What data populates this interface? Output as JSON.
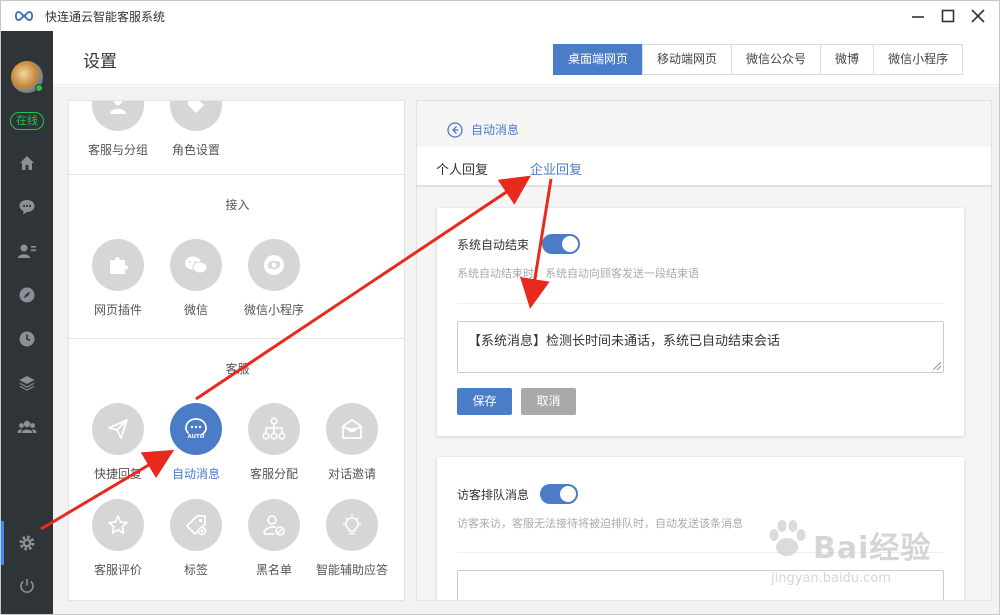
{
  "window": {
    "title": "快连通云智能客服系统",
    "icon": "infinity-logo-icon",
    "controls": [
      "minimize-icon",
      "maximize-icon",
      "close-icon"
    ]
  },
  "sidebar": {
    "status": "在线",
    "items": [
      {
        "icon": "home-icon"
      },
      {
        "icon": "chat-icon"
      },
      {
        "icon": "contacts-icon"
      },
      {
        "icon": "compass-icon"
      },
      {
        "icon": "clock-icon"
      },
      {
        "icon": "layers-icon"
      },
      {
        "icon": "team-icon"
      },
      {
        "icon": "gear-icon",
        "active": true
      },
      {
        "icon": "power-icon"
      }
    ]
  },
  "header": {
    "title": "设置",
    "tabs": [
      {
        "label": "桌面端网页",
        "active": true
      },
      {
        "label": "移动端网页"
      },
      {
        "label": "微信公众号"
      },
      {
        "label": "微博"
      },
      {
        "label": "微信小程序"
      }
    ]
  },
  "left_panel": {
    "top_items": [
      "客服与分组",
      "角色设置"
    ],
    "access": {
      "title": "接入",
      "items": [
        "网页插件",
        "微信",
        "微信小程序"
      ]
    },
    "service": {
      "title": "客服",
      "items": [
        "快捷回复",
        "自动消息",
        "客服分配",
        "对话邀请",
        "客服评价",
        "标签",
        "黑名单",
        "智能辅助应答"
      ],
      "active": "自动消息",
      "active_badge": "AUTO"
    }
  },
  "right_panel": {
    "back_label": "自动消息",
    "subtabs": [
      {
        "label": "个人回复"
      },
      {
        "label": "企业回复",
        "active": true
      }
    ],
    "auto_end": {
      "label": "系统自动结束",
      "enabled": true,
      "hint": "系统自动结束时，系统自动向顾客发送一段结束语",
      "message": "【系统消息】检测长时间未通话，系统已自动结束会话",
      "save": "保存",
      "cancel": "取消"
    },
    "queue": {
      "label": "访客排队消息",
      "enabled": true,
      "hint": "访客来访，客服无法接待将被迫排队时，自动发送该条消息"
    }
  },
  "watermark": {
    "text": "Bai经验",
    "url": "jingyan.baidu.com"
  },
  "colors": {
    "accent": "#4a7cc7",
    "sidebar": "#2f3438",
    "online": "#27c24c",
    "arrow": "#e8291e"
  }
}
